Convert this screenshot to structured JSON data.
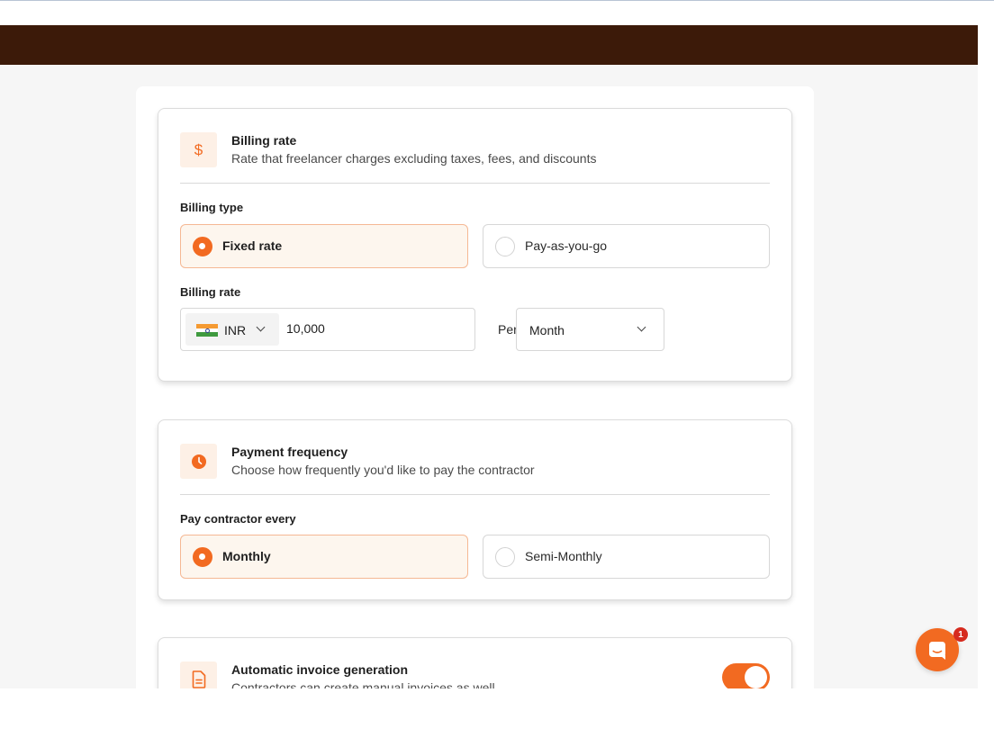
{
  "colors": {
    "brand_bar": "#3c1a09",
    "accent": "#f26a21",
    "page_background": "#f6f6f6",
    "badge": "#d62b1f"
  },
  "billing_card": {
    "icon": "dollar-icon",
    "icon_glyph": "$",
    "title": "Billing rate",
    "subtitle": "Rate that freelancer charges excluding taxes, fees, and discounts",
    "billing_type_label": "Billing type",
    "billing_type_options": [
      {
        "label": "Fixed rate",
        "selected": true
      },
      {
        "label": "Pay-as-you-go",
        "selected": false
      }
    ],
    "billing_rate_label": "Billing rate",
    "currency": {
      "code": "INR",
      "flag_icon": "india-flag-icon"
    },
    "rate_value": "10,000",
    "per_label": "Per",
    "period": "Month"
  },
  "payment_card": {
    "icon": "clock-icon",
    "title": "Payment frequency",
    "subtitle": "Choose how frequently you'd like to pay the contractor",
    "frequency_label": "Pay contractor every",
    "frequency_options": [
      {
        "label": "Monthly",
        "selected": true
      },
      {
        "label": "Semi-Monthly",
        "selected": false
      }
    ]
  },
  "invoice_card": {
    "icon": "document-icon",
    "title": "Automatic invoice generation",
    "subtitle": "Contractors can create manual invoices as well",
    "toggle_on": true
  },
  "chat": {
    "icon": "chat-bubble-icon",
    "badge_count": "1"
  }
}
